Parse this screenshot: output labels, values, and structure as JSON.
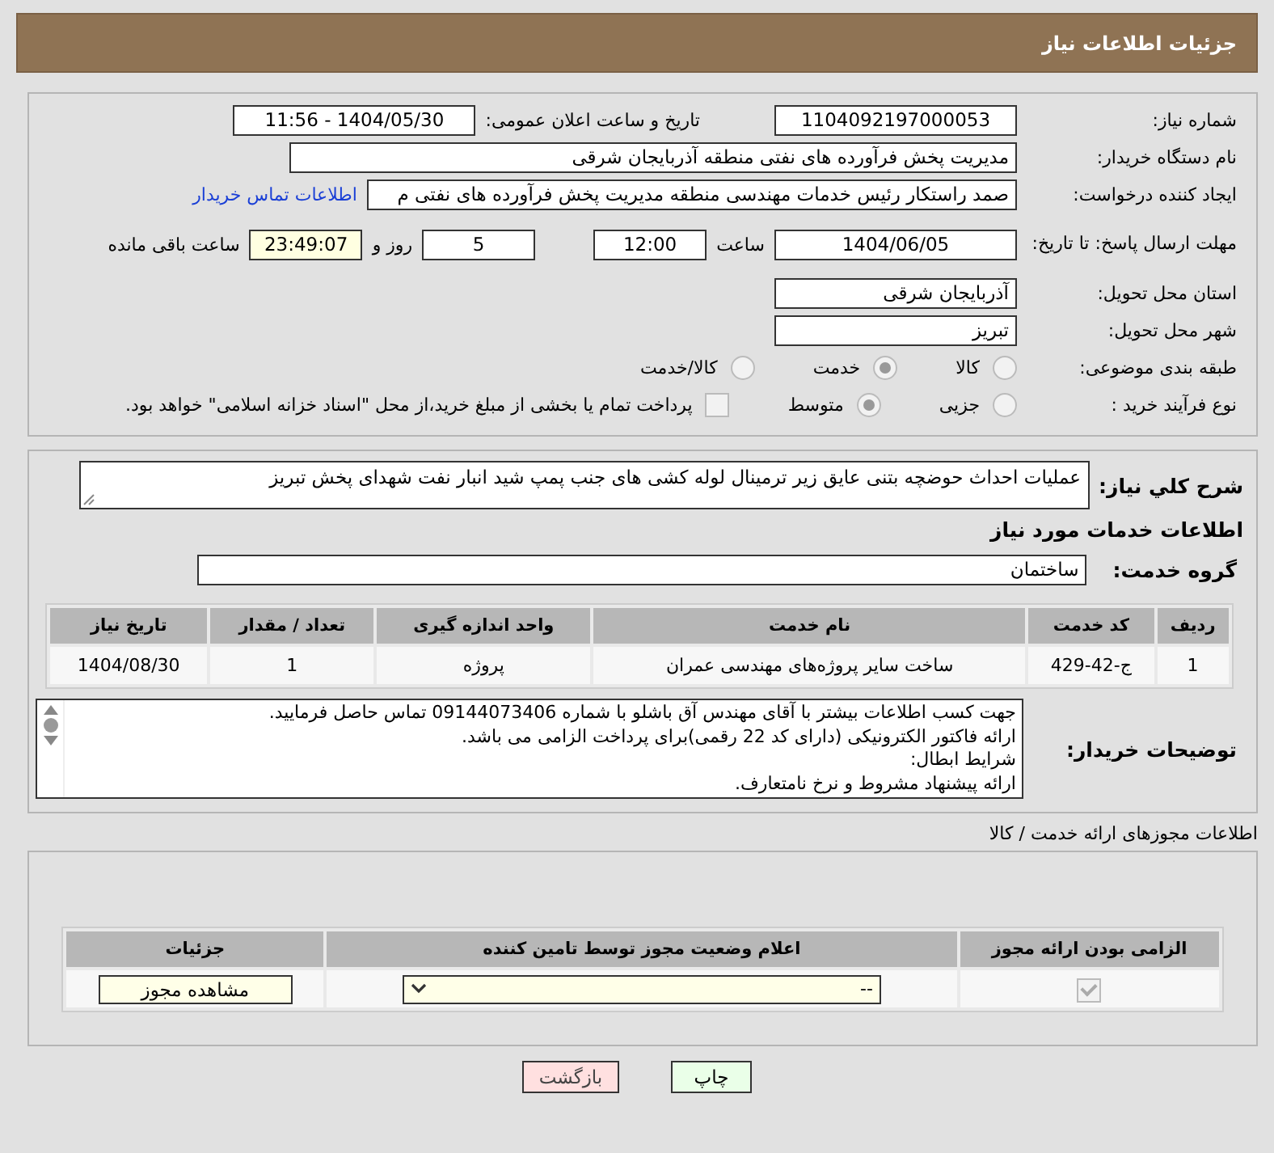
{
  "page_title": "جزئیات اطلاعات نیاز",
  "need_number": {
    "label": "شماره نیاز:",
    "value": "1104092197000053"
  },
  "announce": {
    "label": "تاریخ و ساعت اعلان عمومی:",
    "value": "1404/05/30 - 11:56"
  },
  "buyer": {
    "label": "نام دستگاه خریدار:",
    "value": "مدیریت پخش فرآورده های نفتی منطقه آذربایجان شرقی"
  },
  "requester": {
    "label": "ایجاد کننده درخواست:",
    "value": "صمد راستکار رئیس خدمات مهندسی منطقه مدیریت پخش فرآورده های نفتی م",
    "link": "اطلاعات تماس خریدار"
  },
  "deadline": {
    "label": "مهلت ارسال پاسخ: تا تاریخ:",
    "date": "1404/06/05",
    "time_label": "ساعت",
    "time": "12:00",
    "days": "5",
    "days_label": "روز و",
    "remaining": "23:49:07",
    "remaining_label": "ساعت باقی مانده"
  },
  "province": {
    "label": "استان محل تحویل:",
    "value": "آذربایجان شرقی"
  },
  "city": {
    "label": "شهر محل تحویل:",
    "value": "تبریز"
  },
  "category": {
    "label": "طبقه بندی موضوعی:",
    "options": [
      {
        "label": "کالا",
        "selected": false
      },
      {
        "label": "خدمت",
        "selected": true
      },
      {
        "label": "کالا/خدمت",
        "selected": false
      }
    ]
  },
  "process": {
    "label": "نوع فرآیند خرید :",
    "options": [
      {
        "label": "جزیی",
        "selected": false
      },
      {
        "label": "متوسط",
        "selected": true
      }
    ],
    "payment": {
      "label": "پرداخت تمام یا بخشی از مبلغ خرید،از محل \"اسناد خزانه اسلامی\" خواهد بود.",
      "checked": false
    }
  },
  "description": {
    "label": "شرح کلي نياز:",
    "value": "عملیات احداث حوضچه بتنی عایق زیر ترمینال لوله کشی های جنب پمپ شید انبار نفت شهدای پخش تبریز"
  },
  "services_heading": "اطلاعات خدمات مورد نیاز",
  "service_group": {
    "label": "گروه خدمت:",
    "value": "ساختمان"
  },
  "services_table": {
    "columns": [
      "ردیف",
      "کد خدمت",
      "نام خدمت",
      "واحد اندازه گیری",
      "تعداد / مقدار",
      "تاریخ نیاز"
    ],
    "rows": [
      [
        "1",
        "ج-42-429",
        "ساخت سایر پروژه‌های مهندسی عمران",
        "پروژه",
        "1",
        "1404/08/30"
      ]
    ]
  },
  "buyer_notes": {
    "label": "توضیحات خریدار:",
    "lines": [
      "جهت کسب اطلاعات بیشتر با آقای مهندس آق باشلو با شماره 09144073406 تماس حاصل فرمایید.",
      "ارائه فاکتور الکترونیکی (دارای کد 22 رقمی)برای پرداخت الزامی می باشد.",
      "شرایط ابطال:",
      "ارائه پیشنهاد مشروط و نرخ نامتعارف."
    ]
  },
  "permits": {
    "heading": "اطلاعات مجوزهای ارائه خدمت / کالا",
    "columns": [
      "الزامی بودن ارائه مجوز",
      "اعلام وضعیت مجوز توسط تامین کننده",
      "جزئیات"
    ],
    "rows": [
      {
        "required": true,
        "status": "--",
        "action": "مشاهده مجوز"
      }
    ]
  },
  "buttons": [
    {
      "kind": "print",
      "label": "چاپ"
    },
    {
      "kind": "back",
      "label": "بازگشت"
    }
  ]
}
